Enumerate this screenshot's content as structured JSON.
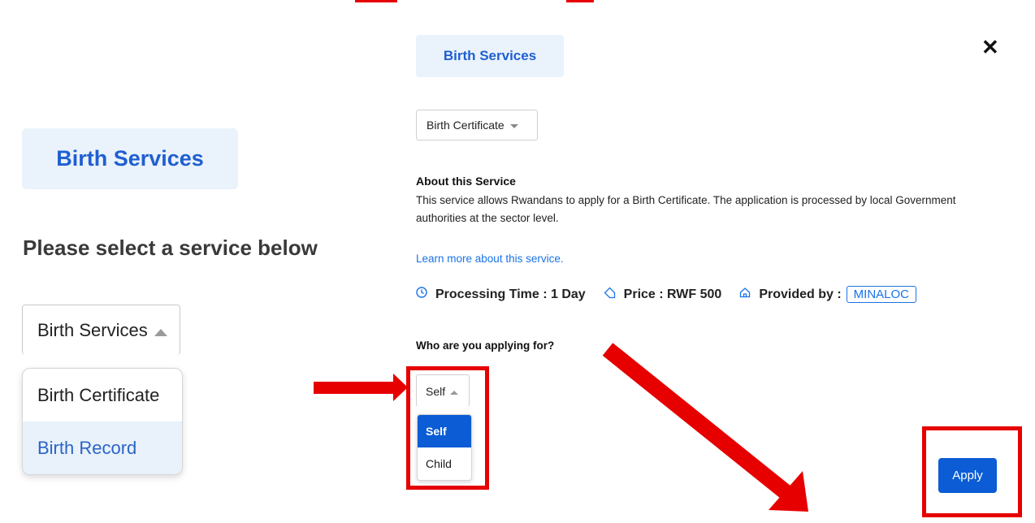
{
  "left": {
    "pill": "Birth Services",
    "heading": "Please select a service below",
    "select_value": "Birth Services",
    "options": [
      "Birth Certificate",
      "Birth Record"
    ]
  },
  "right": {
    "pill": "Birth Services",
    "close": "✕",
    "service_select": "Birth Certificate",
    "about_title": "About this Service",
    "about_text": "This service allows Rwandans to apply for a Birth Certificate. The application is processed by local Government authorities at the sector level.",
    "learn_more": "Learn more about this service.",
    "processing": "Processing Time : 1 Day",
    "price": "Price : RWF 500",
    "provided_by": "Provided by :",
    "provider": "MINALOC",
    "who_label": "Who are you applying for?",
    "who_select": "Self",
    "who_options": [
      "Self",
      "Child"
    ],
    "apply": "Apply"
  },
  "icons": {
    "clock": "clock-icon",
    "tag": "tag-icon",
    "home": "home-icon"
  },
  "colors": {
    "accent": "#1a73e8",
    "primary_button": "#0b5cd5",
    "annotation_red": "#e60000",
    "pill_bg": "#eaf2fb"
  }
}
